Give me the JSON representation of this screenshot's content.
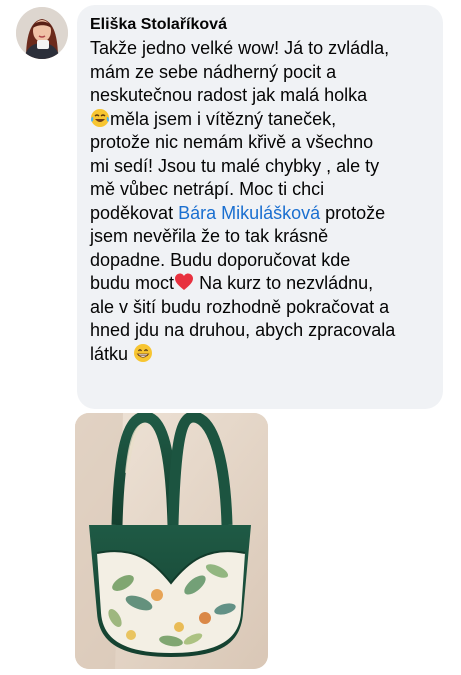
{
  "comment": {
    "author": "Eliška Stolaříková",
    "lines": [
      [
        "Takže jedno velké wow! Já to zvládla,"
      ],
      [
        "mám ze sebe nádherný pocit a"
      ],
      [
        "neskutečnou radost jak malá holka"
      ],
      [
        "",
        "měla jsem i vítězný taneček,"
      ],
      [
        "protože nic nemám křivě a všechno"
      ],
      [
        "mi sedí! Jsou tu malé chybky , ale ty"
      ],
      [
        "mě vůbec netrápí. Moc ti chci"
      ],
      [
        "poděkovat ",
        "Bára Mikulášková",
        " protože"
      ],
      [
        "jsem nevěřila že to tak krásně"
      ],
      [
        "dopadne. Budu doporučovat kde"
      ],
      [
        "budu moct",
        " Na kurz to nezvládnu,"
      ],
      [
        "ale v šití budu rozhodně pokračovat a"
      ],
      [
        "hned jdu na druhou, abych zpracovala"
      ],
      [
        "látku "
      ]
    ],
    "mention": "Bára Mikulášková"
  },
  "emojis": {
    "laughing": "face-with-tears-of-joy-icon",
    "heart": "red-heart-icon",
    "grin": "grinning-face-icon"
  },
  "colors": {
    "bubble_bg": "#f0f2f5",
    "text": "#050505",
    "mention": "#1a6fd0",
    "heart": "#e8313f",
    "emoji_yellow": "#f7c531"
  }
}
